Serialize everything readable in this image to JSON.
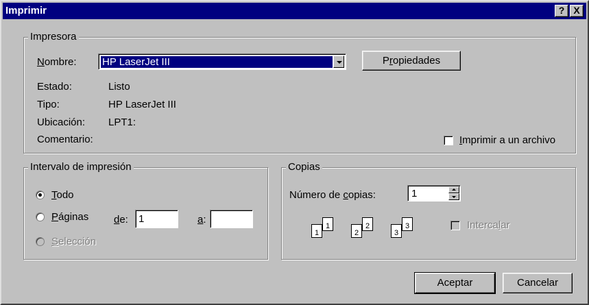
{
  "window": {
    "title": "Imprimir",
    "help_button": "?",
    "close_button": "X"
  },
  "printer": {
    "legend": "Impresora",
    "name_label": "Nombre:",
    "name_value": "HP LaserJet III",
    "properties_button": "Propiedades",
    "status_label": "Estado:",
    "status_value": "Listo",
    "type_label": "Tipo:",
    "type_value": "HP LaserJet III",
    "location_label": "Ubicación:",
    "location_value": "LPT1:",
    "comment_label": "Comentario:",
    "print_to_file_label": "Imprimir a un archivo",
    "print_to_file_checked": false
  },
  "range": {
    "legend": "Intervalo de impresión",
    "all_label": "Todo",
    "pages_label": "Páginas",
    "from_label": "de:",
    "from_value": "1",
    "to_label": "a:",
    "to_value": "",
    "selection_label": "Selección",
    "selected": "all"
  },
  "copies": {
    "legend": "Copias",
    "count_label": "Número de copias:",
    "count_value": "1",
    "collate_label": "Intercalar",
    "collate_enabled": false,
    "page_icons": [
      "1",
      "1",
      "2",
      "2",
      "3",
      "3"
    ]
  },
  "buttons": {
    "ok": "Aceptar",
    "cancel": "Cancelar"
  }
}
